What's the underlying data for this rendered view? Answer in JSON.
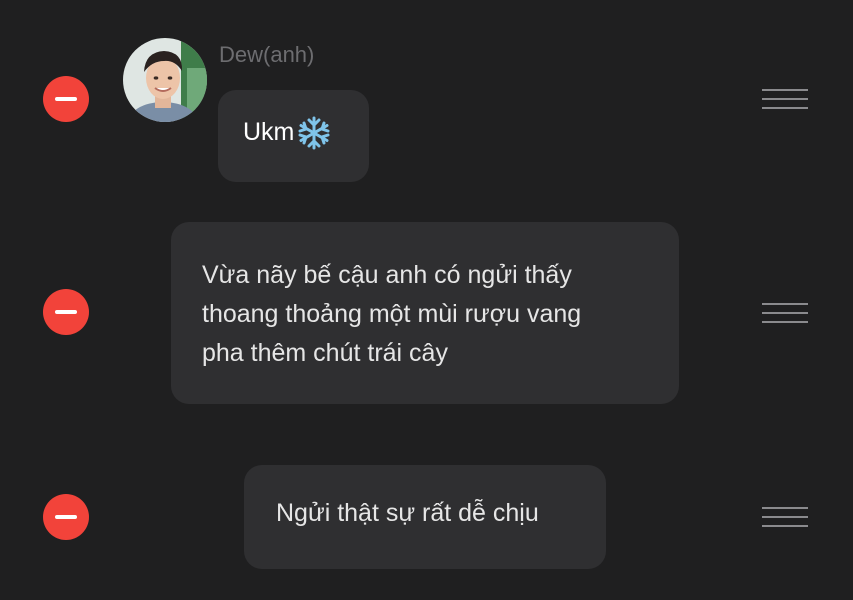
{
  "sender": {
    "name": "Dew(anh)"
  },
  "messages": [
    {
      "text": "Ukm",
      "emoji": "snowflake-icon"
    },
    {
      "lines": [
        "Vừa nãy bế cậu anh có ngửi thấy",
        "thoang thoảng một mùi rượu vang",
        "pha thêm chút trái cây"
      ]
    },
    {
      "text": "Ngửi thật sự rất dễ chịu"
    }
  ],
  "colors": {
    "background": "#1f1f20",
    "bubble": "#2f2f31",
    "remove": "#f2433a",
    "handle": "#8a8a8d",
    "snowflake": "#7fc4ea"
  }
}
